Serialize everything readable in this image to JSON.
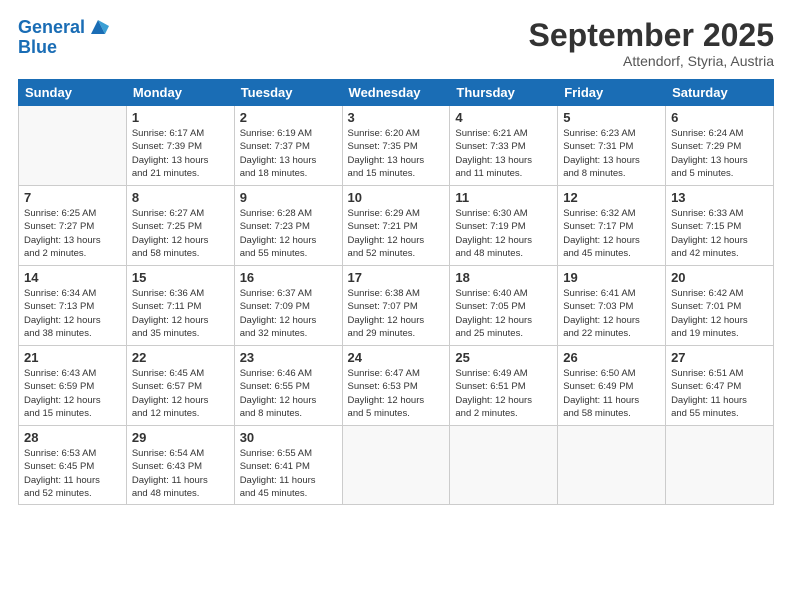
{
  "header": {
    "logo_line1": "General",
    "logo_line2": "Blue",
    "month": "September 2025",
    "location": "Attendorf, Styria, Austria"
  },
  "weekdays": [
    "Sunday",
    "Monday",
    "Tuesday",
    "Wednesday",
    "Thursday",
    "Friday",
    "Saturday"
  ],
  "weeks": [
    [
      {
        "day": "",
        "info": ""
      },
      {
        "day": "1",
        "info": "Sunrise: 6:17 AM\nSunset: 7:39 PM\nDaylight: 13 hours\nand 21 minutes."
      },
      {
        "day": "2",
        "info": "Sunrise: 6:19 AM\nSunset: 7:37 PM\nDaylight: 13 hours\nand 18 minutes."
      },
      {
        "day": "3",
        "info": "Sunrise: 6:20 AM\nSunset: 7:35 PM\nDaylight: 13 hours\nand 15 minutes."
      },
      {
        "day": "4",
        "info": "Sunrise: 6:21 AM\nSunset: 7:33 PM\nDaylight: 13 hours\nand 11 minutes."
      },
      {
        "day": "5",
        "info": "Sunrise: 6:23 AM\nSunset: 7:31 PM\nDaylight: 13 hours\nand 8 minutes."
      },
      {
        "day": "6",
        "info": "Sunrise: 6:24 AM\nSunset: 7:29 PM\nDaylight: 13 hours\nand 5 minutes."
      }
    ],
    [
      {
        "day": "7",
        "info": "Sunrise: 6:25 AM\nSunset: 7:27 PM\nDaylight: 13 hours\nand 2 minutes."
      },
      {
        "day": "8",
        "info": "Sunrise: 6:27 AM\nSunset: 7:25 PM\nDaylight: 12 hours\nand 58 minutes."
      },
      {
        "day": "9",
        "info": "Sunrise: 6:28 AM\nSunset: 7:23 PM\nDaylight: 12 hours\nand 55 minutes."
      },
      {
        "day": "10",
        "info": "Sunrise: 6:29 AM\nSunset: 7:21 PM\nDaylight: 12 hours\nand 52 minutes."
      },
      {
        "day": "11",
        "info": "Sunrise: 6:30 AM\nSunset: 7:19 PM\nDaylight: 12 hours\nand 48 minutes."
      },
      {
        "day": "12",
        "info": "Sunrise: 6:32 AM\nSunset: 7:17 PM\nDaylight: 12 hours\nand 45 minutes."
      },
      {
        "day": "13",
        "info": "Sunrise: 6:33 AM\nSunset: 7:15 PM\nDaylight: 12 hours\nand 42 minutes."
      }
    ],
    [
      {
        "day": "14",
        "info": "Sunrise: 6:34 AM\nSunset: 7:13 PM\nDaylight: 12 hours\nand 38 minutes."
      },
      {
        "day": "15",
        "info": "Sunrise: 6:36 AM\nSunset: 7:11 PM\nDaylight: 12 hours\nand 35 minutes."
      },
      {
        "day": "16",
        "info": "Sunrise: 6:37 AM\nSunset: 7:09 PM\nDaylight: 12 hours\nand 32 minutes."
      },
      {
        "day": "17",
        "info": "Sunrise: 6:38 AM\nSunset: 7:07 PM\nDaylight: 12 hours\nand 29 minutes."
      },
      {
        "day": "18",
        "info": "Sunrise: 6:40 AM\nSunset: 7:05 PM\nDaylight: 12 hours\nand 25 minutes."
      },
      {
        "day": "19",
        "info": "Sunrise: 6:41 AM\nSunset: 7:03 PM\nDaylight: 12 hours\nand 22 minutes."
      },
      {
        "day": "20",
        "info": "Sunrise: 6:42 AM\nSunset: 7:01 PM\nDaylight: 12 hours\nand 19 minutes."
      }
    ],
    [
      {
        "day": "21",
        "info": "Sunrise: 6:43 AM\nSunset: 6:59 PM\nDaylight: 12 hours\nand 15 minutes."
      },
      {
        "day": "22",
        "info": "Sunrise: 6:45 AM\nSunset: 6:57 PM\nDaylight: 12 hours\nand 12 minutes."
      },
      {
        "day": "23",
        "info": "Sunrise: 6:46 AM\nSunset: 6:55 PM\nDaylight: 12 hours\nand 8 minutes."
      },
      {
        "day": "24",
        "info": "Sunrise: 6:47 AM\nSunset: 6:53 PM\nDaylight: 12 hours\nand 5 minutes."
      },
      {
        "day": "25",
        "info": "Sunrise: 6:49 AM\nSunset: 6:51 PM\nDaylight: 12 hours\nand 2 minutes."
      },
      {
        "day": "26",
        "info": "Sunrise: 6:50 AM\nSunset: 6:49 PM\nDaylight: 11 hours\nand 58 minutes."
      },
      {
        "day": "27",
        "info": "Sunrise: 6:51 AM\nSunset: 6:47 PM\nDaylight: 11 hours\nand 55 minutes."
      }
    ],
    [
      {
        "day": "28",
        "info": "Sunrise: 6:53 AM\nSunset: 6:45 PM\nDaylight: 11 hours\nand 52 minutes."
      },
      {
        "day": "29",
        "info": "Sunrise: 6:54 AM\nSunset: 6:43 PM\nDaylight: 11 hours\nand 48 minutes."
      },
      {
        "day": "30",
        "info": "Sunrise: 6:55 AM\nSunset: 6:41 PM\nDaylight: 11 hours\nand 45 minutes."
      },
      {
        "day": "",
        "info": ""
      },
      {
        "day": "",
        "info": ""
      },
      {
        "day": "",
        "info": ""
      },
      {
        "day": "",
        "info": ""
      }
    ]
  ]
}
